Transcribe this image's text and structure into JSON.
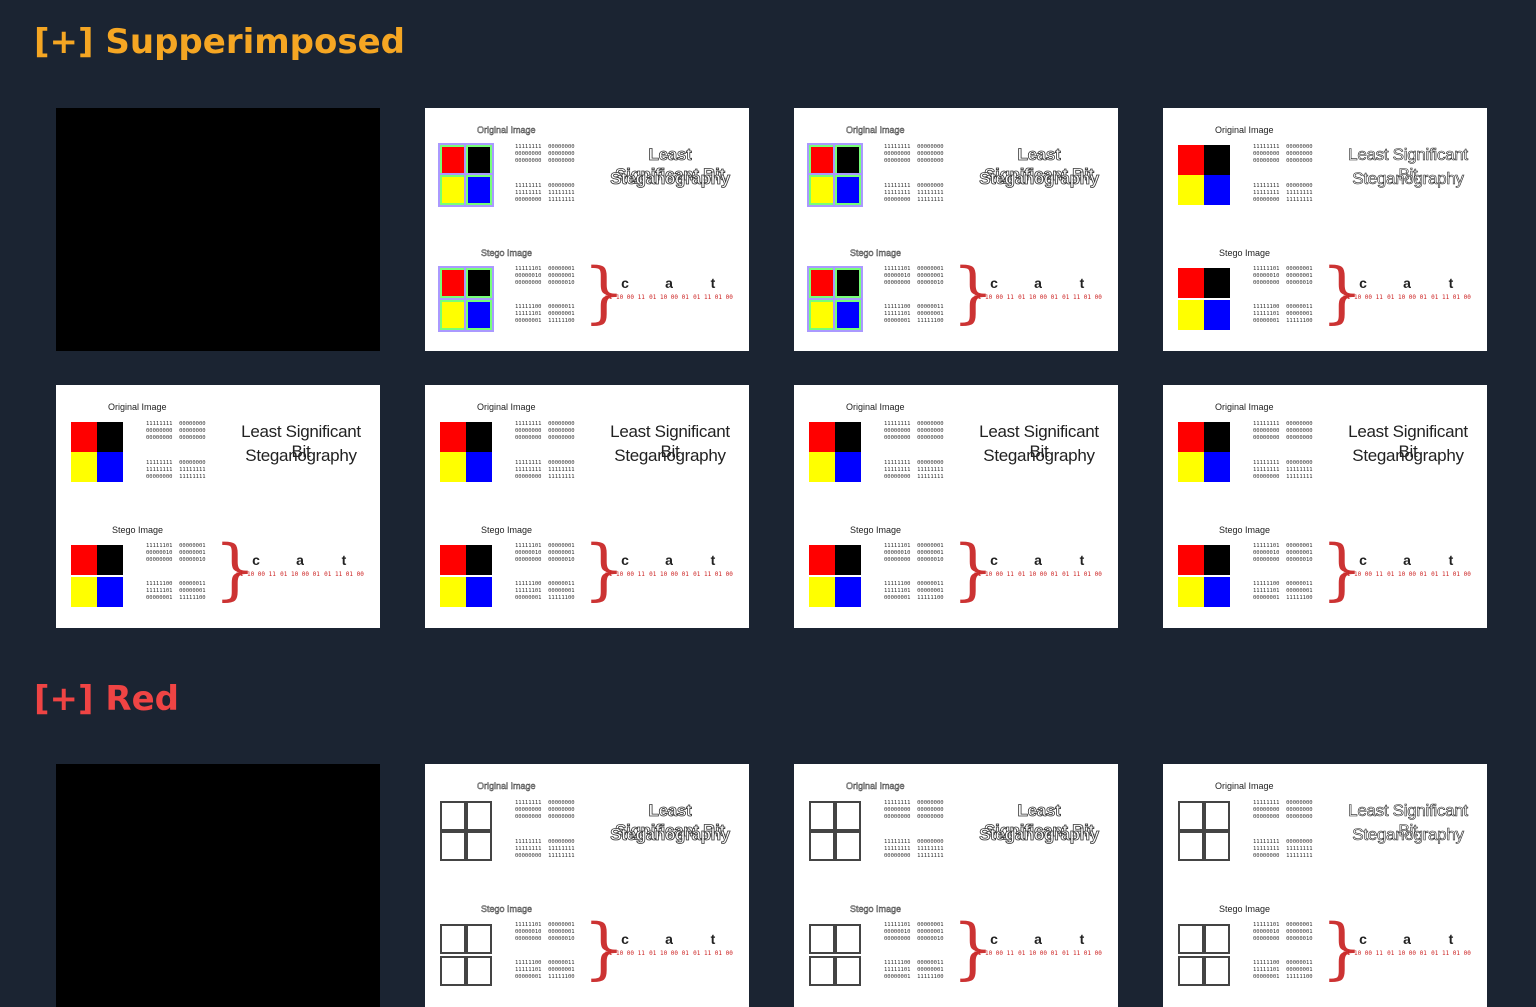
{
  "sections": [
    {
      "title": "[+] Supperimposed",
      "color": "#f5a623"
    },
    {
      "title": "[+] Red",
      "color": "#ef4444"
    }
  ],
  "slide": {
    "original_label": "Original Image",
    "stego_label": "Stego Image",
    "title_line1": "Least Significant Bit",
    "title_line2": "Steganography",
    "letters": [
      "c",
      "a",
      "t"
    ],
    "letter_bits": [
      "01 10 00 11",
      "01 10 00 01",
      "01 11 01 00"
    ],
    "bits_block_a": "11111111  00000000\n00000000  00000000\n00000000  00000000",
    "bits_block_b": "11111111  00000000\n11111111  11111111\n00000000  11111111",
    "stego_bits_a": "11111101  00000001\n00000010  00000001\n00000000  00000010",
    "stego_bits_b": "11111100  00000011\n11111101  00000001\n00000001  11111100"
  },
  "colors": {
    "red": "#ff0000",
    "black": "#000000",
    "yellow": "#ffff00",
    "blue": "#0000ff"
  }
}
